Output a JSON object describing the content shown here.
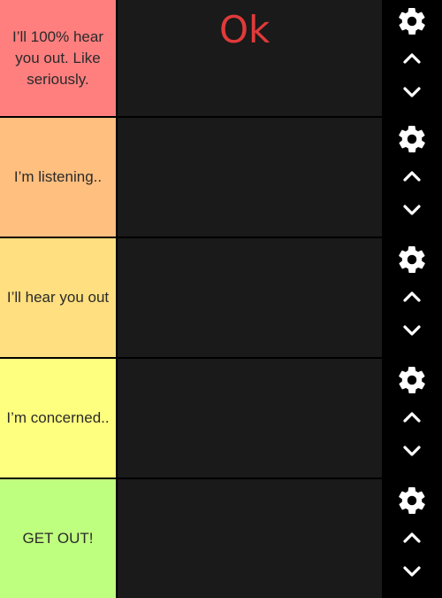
{
  "tiers": [
    {
      "label": "I’ll 100% hear you out. Like seriously.",
      "color": "#ff7f7f"
    },
    {
      "label": "I’m listening..",
      "color": "#ffbf7f"
    },
    {
      "label": "I’ll hear you out",
      "color": "#ffdf7f"
    },
    {
      "label": "I’m concerned..",
      "color": "#ffff7f"
    },
    {
      "label": "GET OUT!",
      "color": "#bfff7f"
    }
  ],
  "items": [
    {
      "tier": 0,
      "text": "Ok",
      "color": "#e03a3a"
    }
  ],
  "icons": {
    "settings": "gear-icon",
    "move_up": "chevron-up-icon",
    "move_down": "chevron-down-icon"
  }
}
